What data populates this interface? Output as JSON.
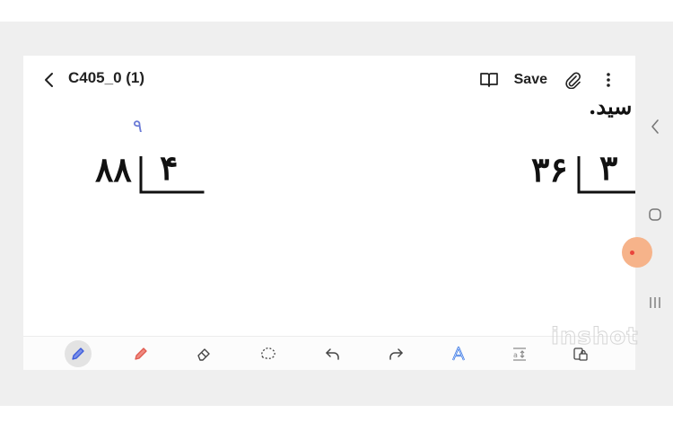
{
  "app": {
    "title": "C405_0 (1)",
    "save_label": "Save"
  },
  "canvas": {
    "partial_heading": "سید.",
    "problems": [
      {
        "dividend": "۸۸",
        "divisor": "۴",
        "annotation": "۹"
      },
      {
        "dividend": "۳۶",
        "divisor": "۳"
      }
    ]
  },
  "toolbar": {
    "tools": [
      "pen-icon",
      "highlighter-icon",
      "eraser-icon",
      "lasso-icon",
      "undo-icon",
      "redo-icon",
      "text-style-icon",
      "spacing-icon",
      "lock-icon"
    ]
  },
  "system_nav": [
    "back-icon",
    "home-icon",
    "recents-icon"
  ],
  "watermark": "inshot",
  "colors": {
    "ink": "#111111",
    "annotation_ink": "#6b7bd6",
    "pen_accent": "#3b5bdb",
    "highlighter_accent": "#e05a4f",
    "text_style_accent": "#2f6fe0"
  }
}
